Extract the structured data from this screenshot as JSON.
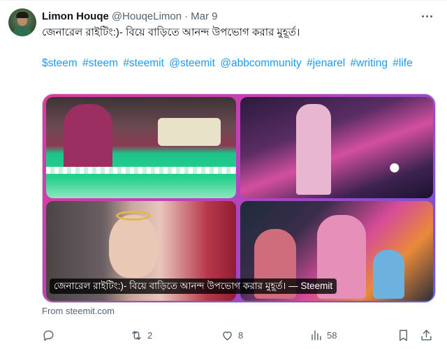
{
  "author": {
    "name": "Limon Houqe",
    "handle": "@HouqeLimon",
    "separator": "·",
    "date": "Mar 9"
  },
  "post": {
    "text": "জেনারেল রাইটিং:)- বিয়ে বাড়িতে আনন্দ উপভোগ করার মুহূর্ত।",
    "hashtags": [
      "$steem",
      "#steem",
      "#steemit",
      "@steemit",
      "@abbcommunity",
      "#jenarel",
      "#writing",
      "#life"
    ]
  },
  "card": {
    "caption": "জেনারেল রাইটিং:)- বিয়ে বাড়িতে আনন্দ উপভোগ করার মুহূর্ত। — Steemit",
    "source": "From steemit.com"
  },
  "actions": {
    "reply_icon": "reply-icon",
    "retweet_icon": "retweet-icon",
    "retweets": "2",
    "like_icon": "heart-icon",
    "likes": "8",
    "views_icon": "bar-chart-icon",
    "views": "58",
    "bookmark_icon": "bookmark-icon",
    "share_icon": "share-icon"
  },
  "colors": {
    "accent": "#1d9bf0",
    "muted": "#536471",
    "text": "#0f1419",
    "border": "#cfd9de"
  }
}
